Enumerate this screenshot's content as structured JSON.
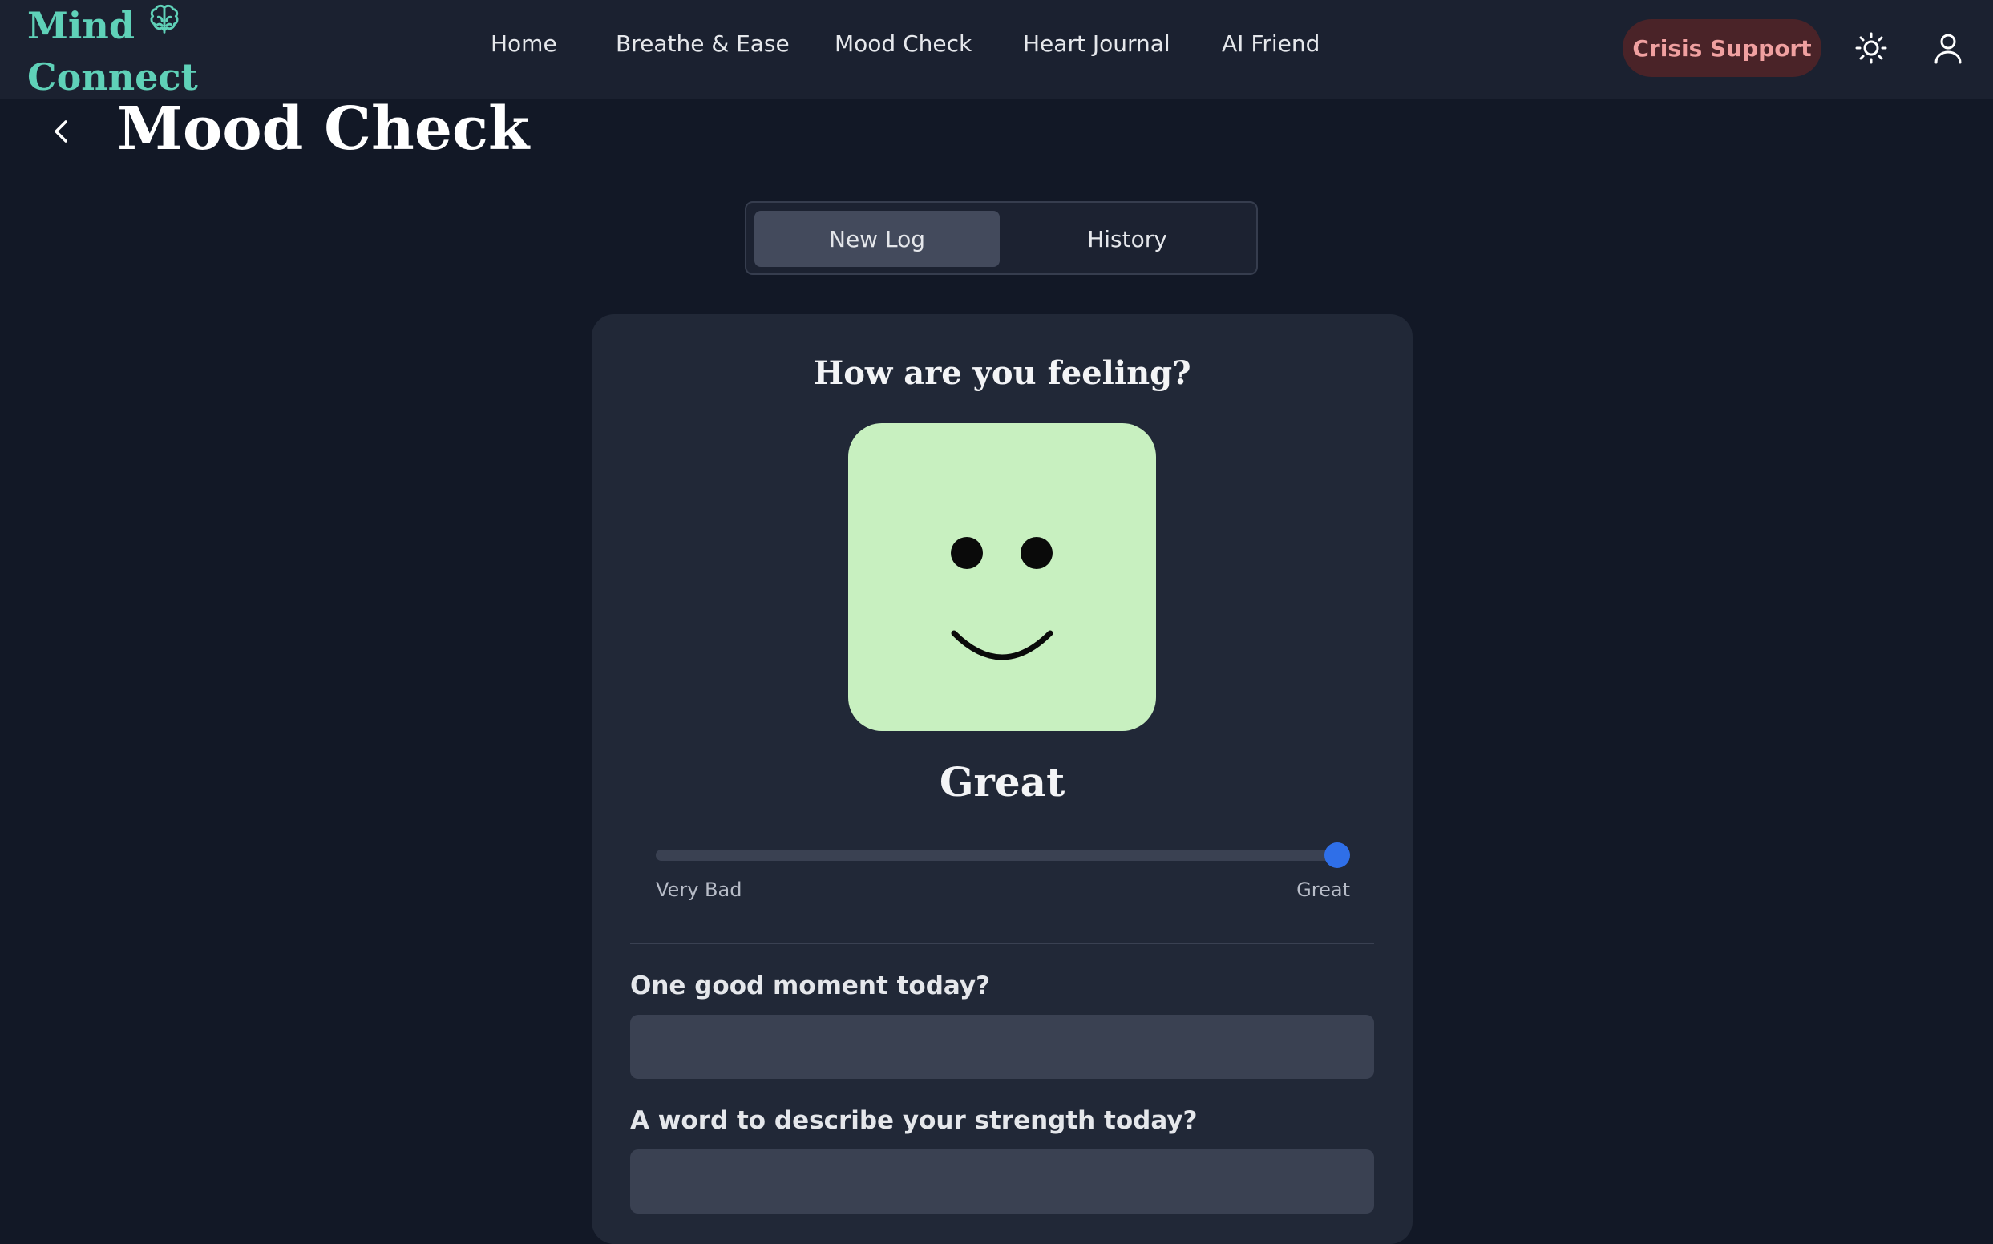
{
  "app": {
    "logo_line1": "Mind",
    "logo_line2": "Connect",
    "accent_color": "#5fd1b8"
  },
  "nav": {
    "items": [
      {
        "label": "Home"
      },
      {
        "label": "Breathe & Ease"
      },
      {
        "label": "Mood Check"
      },
      {
        "label": "Heart Journal"
      },
      {
        "label": "AI Friend"
      }
    ],
    "crisis_label": "Crisis Support",
    "icons": [
      "sun-icon",
      "user-icon"
    ]
  },
  "page": {
    "title": "Mood Check"
  },
  "tabs": [
    {
      "label": "New Log",
      "active": true
    },
    {
      "label": "History",
      "active": false
    }
  ],
  "mood_card": {
    "question": "How are you feeling?",
    "face_color": "#c8f0c0",
    "face_icon": "smiling-face-icon",
    "mood_label": "Great",
    "slider": {
      "value_fraction": 1.0,
      "min_label": "Very Bad",
      "max_label": "Great",
      "thumb_color": "#2f6fe8"
    },
    "fields": [
      {
        "label": "One good moment today?",
        "value": "",
        "placeholder": ""
      },
      {
        "label": "A word to describe your strength today?",
        "value": "",
        "placeholder": ""
      }
    ]
  }
}
